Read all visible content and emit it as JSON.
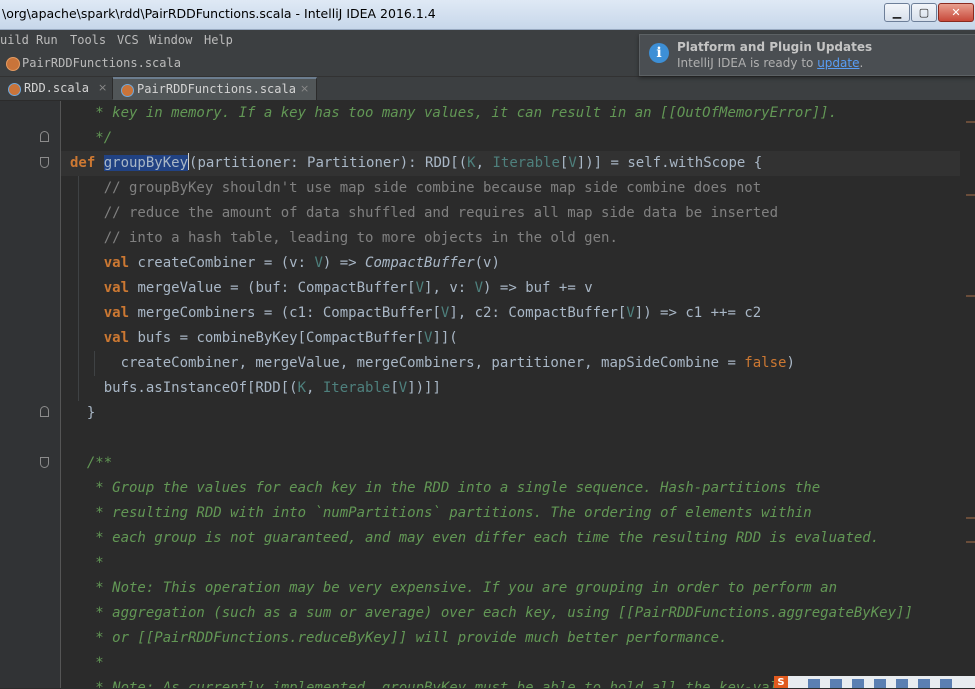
{
  "window": {
    "title": "\\org\\apache\\spark\\rdd\\PairRDDFunctions.scala - IntelliJ IDEA 2016.1.4",
    "min_glyph": "▁",
    "max_glyph": "▢",
    "close_glyph": "✕"
  },
  "menu": [
    "uild",
    "Run",
    "Tools",
    "VCS",
    "Window",
    "Help"
  ],
  "breadcrumb": {
    "label": "PairRDDFunctions.scala"
  },
  "tabs": [
    {
      "label": "RDD.scala",
      "close": "×",
      "active": false
    },
    {
      "label": "PairRDDFunctions.scala",
      "close": "×",
      "active": true
    }
  ],
  "notification": {
    "icon": "i",
    "title": "Platform and Plugin Updates",
    "body_prefix": "IntelliJ IDEA is ready to ",
    "link": "update",
    "body_suffix": "."
  },
  "code": [
    [
      [
        "doc",
        "   * key in memory. If a key has too many values, it can result in an [[OutOfMemoryError]]."
      ]
    ],
    [
      [
        "doc",
        "   */"
      ]
    ],
    [
      [
        "kw",
        "def "
      ],
      [
        "hl",
        "groupByKey"
      ],
      [
        "caret",
        ""
      ],
      [
        "",
        "(partitioner: Partitioner): RDD[("
      ],
      [
        "tp",
        "K"
      ],
      [
        "",
        ", "
      ],
      [
        "tp",
        "Iterable"
      ],
      [
        "",
        "["
      ],
      [
        "tp",
        "V"
      ],
      [
        "",
        "])] = self.withScope {"
      ]
    ],
    [
      [
        "cm",
        "    // groupByKey shouldn't use map side combine because map side combine does not"
      ]
    ],
    [
      [
        "cm",
        "    // reduce the amount of data shuffled and requires all map side data be inserted"
      ]
    ],
    [
      [
        "cm",
        "    // into a hash table, leading to more objects in the old gen."
      ]
    ],
    [
      [
        "",
        "    "
      ],
      [
        "kw",
        "val "
      ],
      [
        "",
        "createCombiner = (v: "
      ],
      [
        "tp",
        "V"
      ],
      [
        "",
        ") => "
      ],
      [
        "it",
        "CompactBuffer"
      ],
      [
        "",
        "(v)"
      ]
    ],
    [
      [
        "",
        "    "
      ],
      [
        "kw",
        "val "
      ],
      [
        "",
        "mergeValue = (buf: CompactBuffer["
      ],
      [
        "tp",
        "V"
      ],
      [
        "",
        "], v: "
      ],
      [
        "tp",
        "V"
      ],
      [
        "",
        ") => buf += v"
      ]
    ],
    [
      [
        "",
        "    "
      ],
      [
        "kw",
        "val "
      ],
      [
        "",
        "mergeCombiners = (c1: CompactBuffer["
      ],
      [
        "tp",
        "V"
      ],
      [
        "",
        "], c2: CompactBuffer["
      ],
      [
        "tp",
        "V"
      ],
      [
        "",
        "]) => c1 ++= c2"
      ]
    ],
    [
      [
        "",
        "    "
      ],
      [
        "kw",
        "val "
      ],
      [
        "",
        "bufs = combineByKey[CompactBuffer["
      ],
      [
        "tp",
        "V"
      ],
      [
        "",
        "]]("
      ]
    ],
    [
      [
        "",
        "      createCombiner, mergeValue, mergeCombiners, partitioner, mapSideCombine = "
      ],
      [
        "kwn",
        "false"
      ],
      [
        "",
        ")"
      ]
    ],
    [
      [
        "",
        "    bufs.asInstanceOf[RDD[("
      ],
      [
        "tp",
        "K"
      ],
      [
        "",
        ", "
      ],
      [
        "tp",
        "Iterable"
      ],
      [
        "",
        "["
      ],
      [
        "tp",
        "V"
      ],
      [
        "",
        "])]]"
      ]
    ],
    [
      [
        "",
        "  }"
      ]
    ],
    [
      [
        "",
        ""
      ]
    ],
    [
      [
        "doc",
        "  /**"
      ]
    ],
    [
      [
        "doc",
        "   * Group the values for each key in the RDD into a single sequence. Hash-partitions the"
      ]
    ],
    [
      [
        "doc",
        "   * resulting RDD with into `numPartitions` partitions. The ordering of elements within"
      ]
    ],
    [
      [
        "doc",
        "   * each group is not guaranteed, and may even differ each time the resulting RDD is evaluated."
      ]
    ],
    [
      [
        "doc",
        "   *"
      ]
    ],
    [
      [
        "doc",
        "   * Note: This operation may be very expensive. If you are grouping in order to perform an"
      ]
    ],
    [
      [
        "doc",
        "   * aggregation (such as a sum or average) over each key, using [[PairRDDFunctions.aggregateByKey]]"
      ]
    ],
    [
      [
        "doc",
        "   * or [[PairRDDFunctions.reduceByKey]] will provide much better performance."
      ]
    ],
    [
      [
        "doc",
        "   *"
      ]
    ],
    [
      [
        "doc",
        "   * Note: As currently implemented, groupByKey must be able to hold all the key-value pai"
      ]
    ]
  ],
  "tray": {
    "logo": "S"
  }
}
